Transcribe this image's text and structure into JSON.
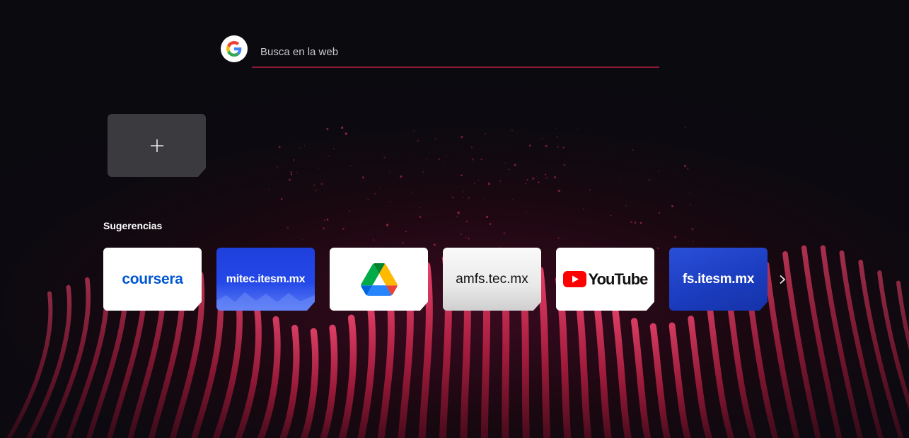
{
  "search": {
    "placeholder": "Busca en la web",
    "engine_icon": "google-icon",
    "underline_color": "#8c1a34"
  },
  "speed_dial": {
    "add_icon": "plus-icon"
  },
  "suggestions": {
    "title": "Sugerencias",
    "next_icon": "chevron-right-icon",
    "tiles": [
      {
        "label": "coursera",
        "brand_color": "#0056d2"
      },
      {
        "label": "mitec.itesm.mx",
        "brand_color": "#2448e8"
      },
      {
        "label": "",
        "icon": "google-drive-icon"
      },
      {
        "label": "amfs.tec.mx",
        "brand_color": "#e5e5e5"
      },
      {
        "label": "YouTube",
        "icon": "youtube-icon",
        "brand_color": "#ff0000"
      },
      {
        "label": "fs.itesm.mx",
        "brand_color": "#1a3bbd"
      }
    ]
  },
  "theme": {
    "background": "#0c0a10",
    "accent": "#d0305a"
  }
}
